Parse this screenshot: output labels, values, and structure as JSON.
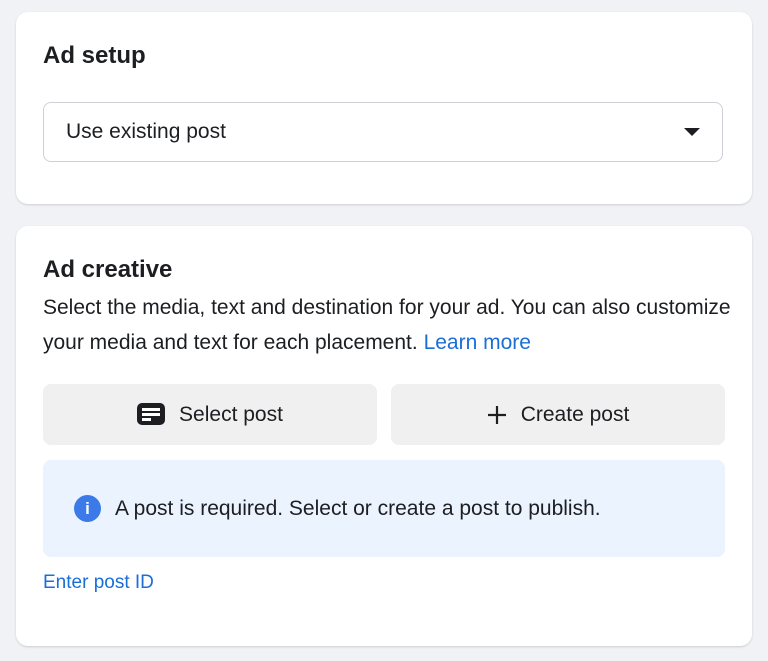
{
  "ad_setup": {
    "title": "Ad setup",
    "dropdown_value": "Use existing post"
  },
  "ad_creative": {
    "title": "Ad creative",
    "description": "Select the media, text and destination for your ad. You can also customize your media and text for each placement.",
    "learn_more": "Learn more",
    "select_post": "Select post",
    "create_post": "Create post",
    "info_message": "A post is required. Select or create a post to publish.",
    "enter_post_id": "Enter post ID"
  }
}
